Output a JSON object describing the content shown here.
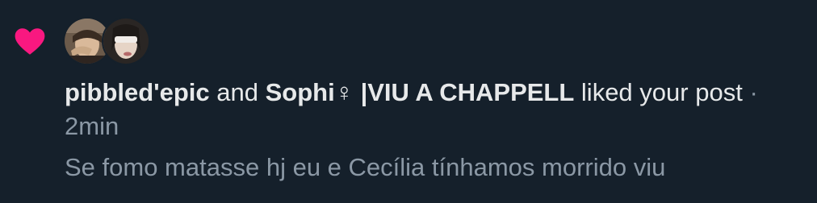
{
  "notification": {
    "icon": "heart-icon",
    "icon_color": "#f91880",
    "user1_name": "pibbled'epic",
    "connector": "and",
    "user2_name": "Sophi♀ |VIU A CHAPPELL",
    "action": "liked your post",
    "separator": "·",
    "time": "2min",
    "post_preview": "Se fomo matasse hj eu e Cecília tínhamos morrido viu"
  },
  "colors": {
    "background": "#15202b",
    "primary_text": "#e7e9ea",
    "secondary_text": "#8b98a5",
    "like_pink": "#f91880"
  }
}
